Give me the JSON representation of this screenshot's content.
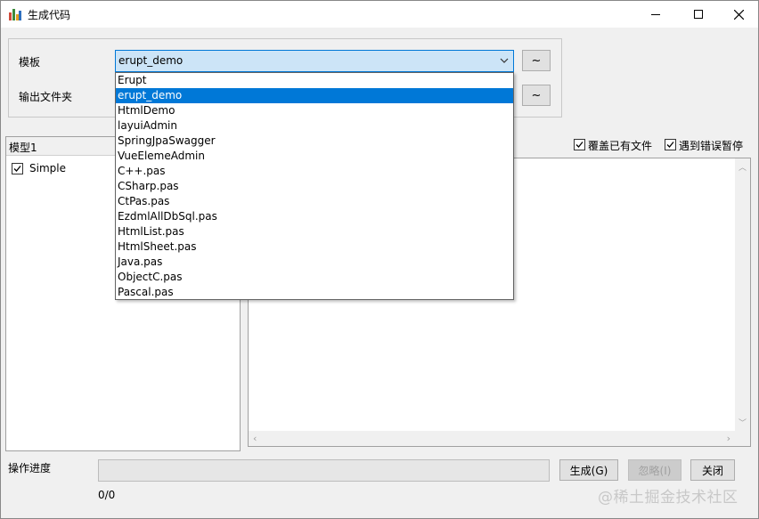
{
  "window": {
    "title": "生成代码",
    "icon": "app-icon",
    "controls": [
      "minimize-icon",
      "maximize-icon",
      "close-icon"
    ]
  },
  "settings": {
    "template_label": "模板",
    "output_folder_label": "输出文件夹",
    "template_value": "erupt_demo",
    "template_browse_label": "~",
    "folder_browse_label": "~"
  },
  "dropdown": {
    "selected": "erupt_demo",
    "items": [
      "Erupt",
      "erupt_demo",
      "HtmlDemo",
      "layuiAdmin",
      "SpringJpaSwagger",
      "VueElemeAdmin",
      "C++.pas",
      "CSharp.pas",
      "CtPas.pas",
      "EzdmlAllDbSql.pas",
      "HtmlList.pas",
      "HtmlSheet.pas",
      "Java.pas",
      "ObjectC.pas",
      "Pascal.pas"
    ]
  },
  "models": {
    "header": "模型1",
    "items": [
      {
        "label": "Simple",
        "checked": true
      }
    ]
  },
  "options": {
    "overwrite_label": "覆盖已有文件",
    "overwrite_checked": true,
    "pause_on_error_label": "遇到错误暂停",
    "pause_on_error_checked": true
  },
  "bottom": {
    "progress_label": "操作进度",
    "progress_value": 0,
    "progress_text": "0/0",
    "generate_label": "生成(G)",
    "ignore_label": "忽略(I)",
    "close_label": "关闭"
  },
  "watermark": "@稀土掘金技术社区",
  "colors": {
    "accent": "#0078d7",
    "combo_bg": "#cce4f7",
    "window_bg": "#f0f0f0"
  }
}
